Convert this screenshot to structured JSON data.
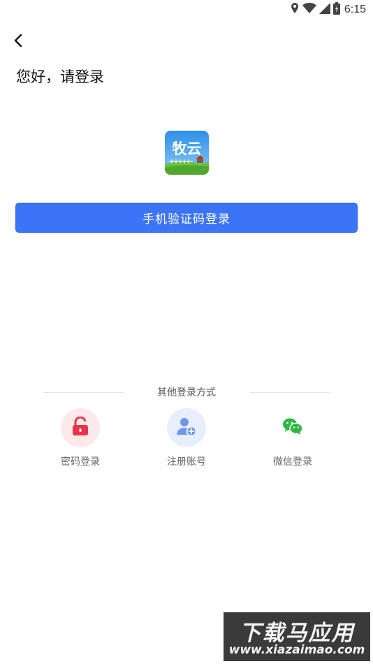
{
  "status_bar": {
    "time": "6:15",
    "icons": [
      "location-icon",
      "wifi-icon",
      "signal-icon",
      "battery-icon"
    ]
  },
  "header": {
    "back_icon": "chevron-left-icon",
    "greeting": "您好，请登录"
  },
  "logo": {
    "text": "牧云",
    "icon": "app-logo-icon"
  },
  "primary_login": {
    "label": "手机验证码登录",
    "color": "#3b74f6"
  },
  "other_methods": {
    "title": "其他登录方式",
    "options": [
      {
        "label": "密码登录",
        "icon": "lock-icon",
        "color": "#e8344a"
      },
      {
        "label": "注册账号",
        "icon": "add-user-icon",
        "color": "#5d8ff0"
      },
      {
        "label": "微信登录",
        "icon": "wechat-icon",
        "color": "#2db941"
      }
    ]
  },
  "watermark": {
    "title": "下载马应用",
    "url": "www.xiazaimao.com"
  }
}
